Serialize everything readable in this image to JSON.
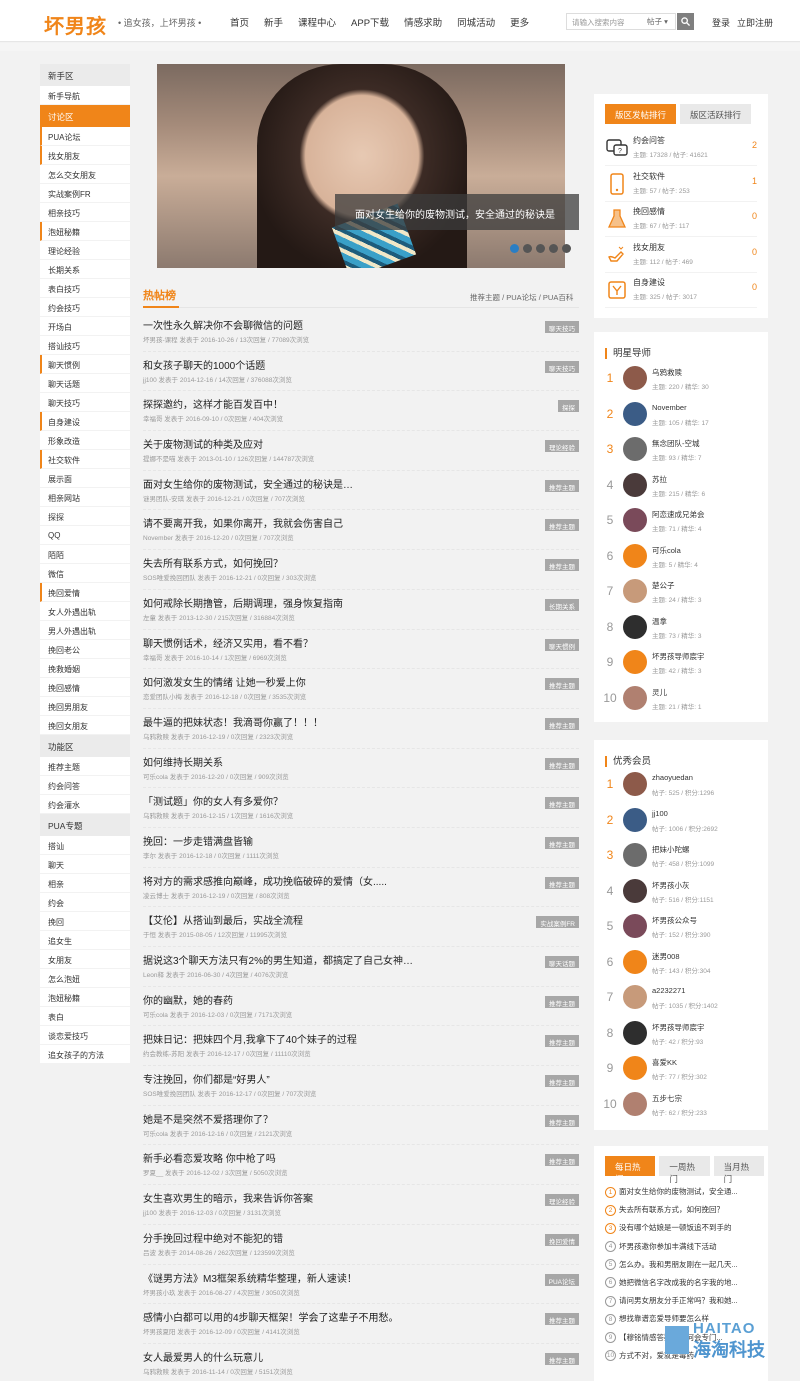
{
  "header": {
    "logo": "坏男孩",
    "slogan": "• 追女孩，上坏男孩 •",
    "nav": [
      "首页",
      "新手",
      "课程中心",
      "APP下载",
      "情感求助",
      "同城活动",
      "更多"
    ],
    "search_placeholder": "请输入搜索内容",
    "search_select": "帖子",
    "login": "登录",
    "register": "立即注册"
  },
  "sidebar": [
    {
      "type": "sec",
      "label": "新手区"
    },
    {
      "type": "item",
      "label": "新手导航"
    },
    {
      "type": "sec",
      "label": "讨论区",
      "active": true
    },
    {
      "type": "sub",
      "label": "PUA论坛"
    },
    {
      "type": "sub",
      "label": "找女朋友"
    },
    {
      "type": "item",
      "label": "怎么交女朋友"
    },
    {
      "type": "item",
      "label": "实战案例FR"
    },
    {
      "type": "item",
      "label": "相亲技巧"
    },
    {
      "type": "sub",
      "label": "泡妞秘籍"
    },
    {
      "type": "item",
      "label": "理论经验"
    },
    {
      "type": "item",
      "label": "长期关系"
    },
    {
      "type": "item",
      "label": "表白技巧"
    },
    {
      "type": "item",
      "label": "约会技巧"
    },
    {
      "type": "item",
      "label": "开场白"
    },
    {
      "type": "item",
      "label": "搭讪技巧"
    },
    {
      "type": "sub",
      "label": "聊天惯例"
    },
    {
      "type": "item",
      "label": "聊天话题"
    },
    {
      "type": "item",
      "label": "聊天技巧"
    },
    {
      "type": "sub",
      "label": "自身建设"
    },
    {
      "type": "item",
      "label": "形象改造"
    },
    {
      "type": "sub",
      "label": "社交软件"
    },
    {
      "type": "item",
      "label": "展示面"
    },
    {
      "type": "item",
      "label": "相亲网站"
    },
    {
      "type": "item",
      "label": "探探"
    },
    {
      "type": "item",
      "label": "QQ"
    },
    {
      "type": "item",
      "label": "陌陌"
    },
    {
      "type": "item",
      "label": "微信"
    },
    {
      "type": "sub",
      "label": "挽回爱情"
    },
    {
      "type": "item",
      "label": "女人外遇出轨"
    },
    {
      "type": "item",
      "label": "男人外遇出轨"
    },
    {
      "type": "item",
      "label": "挽回老公"
    },
    {
      "type": "item",
      "label": "挽救婚姻"
    },
    {
      "type": "item",
      "label": "挽回感情"
    },
    {
      "type": "item",
      "label": "挽回男朋友"
    },
    {
      "type": "item",
      "label": "挽回女朋友"
    },
    {
      "type": "sec",
      "label": "功能区"
    },
    {
      "type": "item",
      "label": "推荐主题"
    },
    {
      "type": "item",
      "label": "约会问答"
    },
    {
      "type": "item",
      "label": "约会灌水"
    },
    {
      "type": "sec",
      "label": "PUA专题"
    },
    {
      "type": "item",
      "label": "搭讪"
    },
    {
      "type": "item",
      "label": "聊天"
    },
    {
      "type": "item",
      "label": "相亲"
    },
    {
      "type": "item",
      "label": "约会"
    },
    {
      "type": "item",
      "label": "挽回"
    },
    {
      "type": "item",
      "label": "追女生"
    },
    {
      "type": "item",
      "label": "女朋友"
    },
    {
      "type": "item",
      "label": "怎么泡妞"
    },
    {
      "type": "item",
      "label": "泡妞秘籍"
    },
    {
      "type": "item",
      "label": "表白"
    },
    {
      "type": "item",
      "label": "谈恋爱技巧"
    },
    {
      "type": "item",
      "label": "追女孩子的方法"
    }
  ],
  "banner": {
    "caption": "面对女生给你的废物测试，安全通过的秘诀是"
  },
  "hot": {
    "title": "热帖榜",
    "links": "推荐主题 / PUA论坛 / PUA百科",
    "threads": [
      {
        "t": "一次性永久解决你不会聊微信的问题",
        "m": "坏男孩-课程 发表于 2016-10-26 / 13次回复 / 77089次浏览",
        "tag": "聊天技巧"
      },
      {
        "t": "和女孩子聊天的1000个话题",
        "m": "jj100 发表于 2014-12-16 / 14次回复 / 376088次浏览",
        "tag": "聊天技巧"
      },
      {
        "t": "探探邀约，这样才能百发百中！",
        "m": "幸福哥 发表于 2016-09-10 / 0次回复 / 404次浏览",
        "tag": "探探"
      },
      {
        "t": "关于废物测试的种类及应对",
        "m": "提娜不是喵 发表于 2013-01-10 / 126次回复 / 144787次浏览",
        "tag": "理论经验"
      },
      {
        "t": "面对女生给你的废物测试，安全通过的秘诀是…",
        "m": "谜男团队-安琪 发表于 2016-12-21 / 0次回复 / 707次浏览",
        "tag": "推荐主题"
      },
      {
        "t": "请不要离开我，如果你离开，我就会伤害自己",
        "m": "November 发表于 2016-12-20 / 0次回复 / 707次浏览",
        "tag": "推荐主题"
      },
      {
        "t": "失去所有联系方式，如何挽回？",
        "m": "SOS唯爱挽回团队 发表于 2016-12-21 / 0次回复 / 303次浏览",
        "tag": "推荐主题"
      },
      {
        "t": "如何戒除长期撸管，后期调理，强身恢复指南",
        "m": "左童 发表于 2013-12-30 / 215次回复 / 316884次浏览",
        "tag": "长期关系"
      },
      {
        "t": "聊天惯例话术，经济又实用，看不看？",
        "m": "幸福哥 发表于 2016-10-14 / 1次回复 / 6969次浏览",
        "tag": "聊天惯例"
      },
      {
        "t": "如何激发女生的情绪 让她一秒爱上你",
        "m": "恋爱团队小梅 发表于 2016-12-18 / 0次回复 / 3535次浏览",
        "tag": "推荐主题"
      },
      {
        "t": "最牛逼的把妹状态！我滴哥你赢了！！！",
        "m": "乌鸦救赎 发表于 2016-12-19 / 0次回复 / 2323次浏览",
        "tag": "推荐主题"
      },
      {
        "t": "如何维持长期关系",
        "m": "可乐cola 发表于 2016-12-20 / 0次回复 / 909次浏览",
        "tag": "推荐主题"
      },
      {
        "t": "「测试题」你的女人有多爱你？",
        "m": "乌鸦救赎 发表于 2016-12-15 / 1次回复 / 1616次浏览",
        "tag": "推荐主题"
      },
      {
        "t": "挽回：一步走错满盘皆输",
        "m": "李尔 发表于 2016-12-18 / 0次回复 / 1111次浏览",
        "tag": "推荐主题"
      },
      {
        "t": "将对方的需求感推向巅峰，成功挽临破碎的爱情（女.....",
        "m": "凌云博士 发表于 2016-12-19 / 0次回复 / 808次浏览",
        "tag": "推荐主题"
      },
      {
        "t": "【艾伦】从搭讪到最后，实战全流程",
        "m": "于恒 发表于 2015-08-05 / 12次回复 / 11995次浏览",
        "tag": "实战案例FR"
      },
      {
        "t": "据说这3个聊天方法只有2%的男生知道，都搞定了自己女神…",
        "m": "Leon释 发表于 2016-06-30 / 4次回复 / 4076次浏览",
        "tag": "聊天话题"
      },
      {
        "t": "你的幽默，她的春药",
        "m": "可乐cola 发表于 2016-12-03 / 0次回复 / 7171次浏览",
        "tag": "推荐主题"
      },
      {
        "t": "把妹日记：把妹四个月,我拿下了40个妹子的过程",
        "m": "约会教练-苏阳 发表于 2016-12-17 / 0次回复 / 11110次浏览",
        "tag": "推荐主题"
      },
      {
        "t": "专注挽回，你们都是“好男人”",
        "m": "SOS唯爱挽回团队 发表于 2016-12-17 / 0次回复 / 707次浏览",
        "tag": "推荐主题"
      },
      {
        "t": "她是不是突然不爱搭理你了？",
        "m": "可乐cola 发表于 2016-12-16 / 0次回复 / 2121次浏览",
        "tag": "推荐主题"
      },
      {
        "t": "新手必看恋爱攻略 你中枪了吗",
        "m": "罗夏__ 发表于 2016-12-02 / 3次回复 / 5050次浏览",
        "tag": "推荐主题"
      },
      {
        "t": "女生喜欢男生的暗示，我来告诉你答案",
        "m": "jj100 发表于 2016-12-03 / 0次回复 / 3131次浏览",
        "tag": "理论经验"
      },
      {
        "t": "分手挽回过程中绝对不能犯的错",
        "m": "吕波 发表于 2014-08-26 / 262次回复 / 123599次浏览",
        "tag": "挽回爱情"
      },
      {
        "t": "《谜男方法》M3框架系统精华整理，新人速读！",
        "m": "坏男孩小玖 发表于 2016-08-27 / 4次回复 / 3050次浏览",
        "tag": "PUA论坛"
      },
      {
        "t": "感情小白都可以用的4步聊天框架！学会了这辈子不用愁。",
        "m": "坏男孩夏阳 发表于 2016-12-09 / 0次回复 / 4141次浏览",
        "tag": "推荐主题"
      },
      {
        "t": "女人最爱男人的什么玩意儿",
        "m": "乌鸦救赎 发表于 2016-11-14 / 0次回复 / 5151次浏览",
        "tag": "推荐主题"
      }
    ]
  },
  "board_rank": {
    "tabs": [
      "版区发帖排行",
      "版区活跃排行"
    ],
    "items": [
      {
        "name": "约会问答",
        "stat": "主题: 17328 / 帖子: 41621",
        "rank": "2",
        "icon": "qa-icon"
      },
      {
        "name": "社交软件",
        "stat": "主题: 57 / 帖子: 253",
        "rank": "1",
        "icon": "phone-icon"
      },
      {
        "name": "挽回感情",
        "stat": "主题: 67 / 帖子: 117",
        "rank": "0",
        "icon": "flask-icon"
      },
      {
        "name": "找女朋友",
        "stat": "主题: 112 / 帖子: 469",
        "rank": "0",
        "icon": "hand-icon"
      },
      {
        "name": "自身建设",
        "stat": "主题: 325 / 帖子: 3017",
        "rank": "0",
        "icon": "book-icon"
      }
    ]
  },
  "mentors": {
    "title": "明星导师",
    "items": [
      {
        "no": "1",
        "name": "乌鸦救赎",
        "stat": "主题: 220 / 精华: 30"
      },
      {
        "no": "2",
        "name": "November",
        "stat": "主题: 105 / 精华: 17"
      },
      {
        "no": "3",
        "name": "無念团队-空城",
        "stat": "主题: 93 / 精华: 7"
      },
      {
        "no": "4",
        "name": "苏拉",
        "stat": "主题: 215 / 精华: 6"
      },
      {
        "no": "5",
        "name": "阿恋速成兄弟会",
        "stat": "主题: 71 / 精华: 4"
      },
      {
        "no": "6",
        "name": "可乐cola",
        "stat": "主题: 5 / 精华: 4"
      },
      {
        "no": "7",
        "name": "楚公子",
        "stat": "主题: 24 / 精华: 3"
      },
      {
        "no": "8",
        "name": "温拿",
        "stat": "主题: 73 / 精华: 3"
      },
      {
        "no": "9",
        "name": "坏男孩导师宸宇",
        "stat": "主题: 42 / 精华: 3"
      },
      {
        "no": "10",
        "name": "灵儿",
        "stat": "主题: 21 / 精华: 1"
      }
    ]
  },
  "members": {
    "title": "优秀会员",
    "items": [
      {
        "no": "1",
        "name": "zhaoyuedan",
        "stat": "帖子: 525 / 积分:1296"
      },
      {
        "no": "2",
        "name": "jj100",
        "stat": "帖子: 1006 / 积分:2692"
      },
      {
        "no": "3",
        "name": "把妹小陀螺",
        "stat": "帖子: 458 / 积分:1099"
      },
      {
        "no": "4",
        "name": "坏男孩小灰",
        "stat": "帖子: 516 / 积分:1151"
      },
      {
        "no": "5",
        "name": "坏男孩公众号",
        "stat": "帖子: 152 / 积分:390"
      },
      {
        "no": "6",
        "name": "迷男008",
        "stat": "帖子: 143 / 积分:304"
      },
      {
        "no": "7",
        "name": "a2232271",
        "stat": "帖子: 1035 / 积分:1402"
      },
      {
        "no": "8",
        "name": "坏男孩导师宸宇",
        "stat": "帖子: 42 / 积分:93"
      },
      {
        "no": "9",
        "name": "喜爱KK",
        "stat": "帖子: 77 / 积分:302"
      },
      {
        "no": "10",
        "name": "五步七宗",
        "stat": "帖子: 62 / 积分:233"
      }
    ]
  },
  "daily_hot": {
    "tabs": [
      "每日热门",
      "一周热门",
      "当月热门"
    ],
    "items": [
      {
        "no": "1",
        "t": "面对女生给你的废物测试，安全通..."
      },
      {
        "no": "2",
        "t": "失去所有联系方式，如何挽回？"
      },
      {
        "no": "3",
        "t": "没有哪个姑娘是一顿饭追不到手的"
      },
      {
        "no": "4",
        "t": "坏男孩邀你参加丰满线下活动"
      },
      {
        "no": "5",
        "t": "怎么办。我和男朋友刚在一起几天..."
      },
      {
        "no": "6",
        "t": "她把微信名字改成我的名字我的地..."
      },
      {
        "no": "7",
        "t": "请问男女朋友分手正常吗？我和她..."
      },
      {
        "no": "8",
        "t": "想找靠谱恋爱导师要怎么样"
      },
      {
        "no": "9",
        "t": "【穆铭情感答疑】为何会专门..."
      },
      {
        "no": "10",
        "t": "方式不对，爱就是毒药"
      }
    ]
  },
  "watermark": {
    "line1": "HAITAO",
    "line2": "海淘科技"
  },
  "colors": {
    "accent": "#f08519",
    "tag": "#a7a7a7"
  }
}
